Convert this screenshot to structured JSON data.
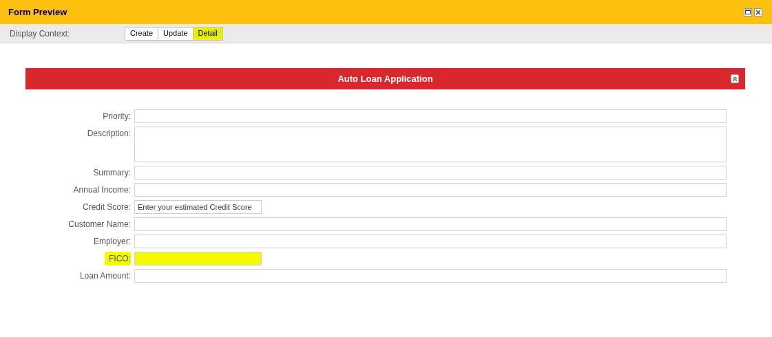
{
  "window": {
    "title": "Form Preview"
  },
  "toolbar": {
    "label": "Display Context:",
    "buttons": [
      {
        "label": "Create",
        "selected": false,
        "highlighted": false
      },
      {
        "label": "Update",
        "selected": false,
        "highlighted": false
      },
      {
        "label": "Detail",
        "selected": true,
        "highlighted": true
      }
    ]
  },
  "section": {
    "title": "Auto Loan Application",
    "expanded": true
  },
  "fields": [
    {
      "label": "Priority:",
      "kind": "text",
      "highlighted": false
    },
    {
      "label": "Description:",
      "kind": "textarea",
      "highlighted": false
    },
    {
      "label": "Summary:",
      "kind": "text",
      "highlighted": false
    },
    {
      "label": "Annual Income:",
      "kind": "text",
      "highlighted": false
    },
    {
      "label": "Credit Score:",
      "kind": "short",
      "placeholder": "Enter your estimated Credit Score",
      "highlighted": false
    },
    {
      "label": "Customer Name:",
      "kind": "text",
      "highlighted": false
    },
    {
      "label": "Employer:",
      "kind": "text",
      "highlighted": false
    },
    {
      "label": "FICO:",
      "kind": "short",
      "highlighted": true
    },
    {
      "label": "Loan Amount:",
      "kind": "text",
      "highlighted": false
    }
  ]
}
